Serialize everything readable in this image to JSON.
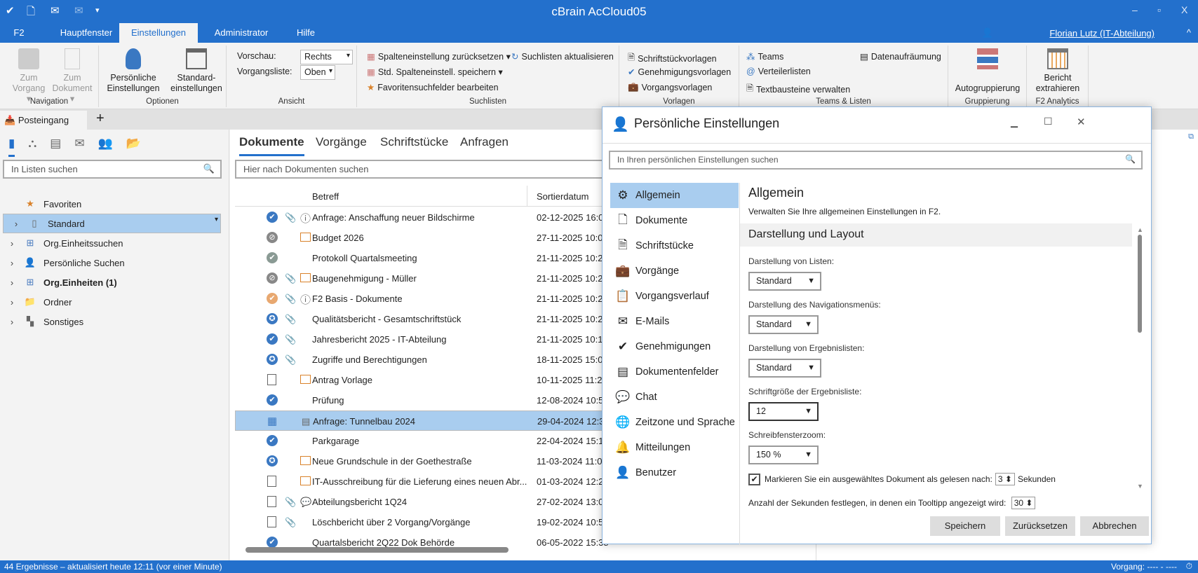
{
  "window": {
    "title": "cBrain AcCloud05",
    "minimize": "–",
    "maximize": "▫",
    "close": "X"
  },
  "quick_access": [
    "✔",
    "🗋",
    "✉",
    "✉",
    "▾"
  ],
  "menu": {
    "tabs": [
      "F2",
      "Hauptfenster",
      "Einstellungen",
      "Administrator",
      "Hilfe"
    ],
    "active": "Einstellungen",
    "user": "Florian Lutz (IT-Abteilung)",
    "collapse": "^"
  },
  "ribbon": {
    "navigation": {
      "label": "Navigation",
      "zum_vorgang": "Zum Vorgang ▾",
      "zum_dokument": "Zum Dokument ▾"
    },
    "optionen": {
      "label": "Optionen",
      "persoenlich": "Persönliche Einstellungen",
      "standard": "Standard-einstellungen"
    },
    "ansicht": {
      "label": "Ansicht",
      "vorschau_label": "Vorschau:",
      "vorschau_value": "Rechts",
      "vorgangsliste_label": "Vorgangsliste:",
      "vorgangsliste_value": "Oben"
    },
    "suchlisten": {
      "label": "Suchlisten",
      "reset": "Spalteneinstellung zurücksetzen ▾",
      "save": "Std. Spalteneinstell. speichern ▾",
      "fav": "Favoritensuchfelder bearbeiten",
      "refresh": "Suchlisten aktualisieren"
    },
    "vorlagen": {
      "label": "Vorlagen",
      "items": [
        "Schriftstückvorlagen",
        "Genehmigungsvorlagen",
        "Vorgangsvorlagen"
      ]
    },
    "teams": {
      "label": "Teams & Listen",
      "items": [
        "Teams",
        "Verteilerlisten",
        "Textbausteine verwalten",
        "Datenaufräumung"
      ]
    },
    "gruppierung": {
      "label": "Gruppierung",
      "auto": "Autogruppierung"
    },
    "analytics": {
      "label": "F2 Analytics",
      "bericht": "Bericht extrahieren"
    }
  },
  "doc_tab": {
    "label": "Posteingang",
    "add": "+"
  },
  "left": {
    "search_placeholder": "In Listen suchen",
    "tree": [
      {
        "label": "Favoriten",
        "icon": "★",
        "color": "#d9822b",
        "chev": ""
      },
      {
        "label": "Standard",
        "icon": "▯",
        "color": "#666",
        "chev": "›"
      },
      {
        "label": "Org.Einheitssuchen",
        "icon": "⊞",
        "color": "#4a7bbf",
        "chev": "›"
      },
      {
        "label": "Persönliche Suchen",
        "icon": "👤",
        "color": "#4a7bbf",
        "chev": "›"
      },
      {
        "label": "Org.Einheiten (1)",
        "icon": "⊞",
        "color": "#4a7bbf",
        "chev": "›"
      },
      {
        "label": "Ordner",
        "icon": "📁",
        "color": "#e8a860",
        "chev": "›"
      },
      {
        "label": "Sonstiges",
        "icon": "▚",
        "color": "#666",
        "chev": "›"
      }
    ]
  },
  "center": {
    "tabs": [
      "Dokumente",
      "Vorgänge",
      "Schriftstücke",
      "Anfragen"
    ],
    "search_placeholder": "Hier nach Dokumenten suchen",
    "columns": [
      "Betreff",
      "Sortierdatum"
    ],
    "rows": [
      {
        "status": "check",
        "status_color": "#3a78c2",
        "clip": true,
        "extra": "ⓘ",
        "subject": "Anfrage: Anschaffung neuer Bildschirme",
        "date": "02-12-2025 16:07"
      },
      {
        "status": "blocked",
        "status_color": "#888",
        "clip": false,
        "extra": "folder",
        "subject": "Budget 2026",
        "date": "27-11-2025 10:09"
      },
      {
        "status": "check",
        "status_color": "#8a9a94",
        "clip": false,
        "extra": "",
        "subject": "Protokoll Quartalsmeeting",
        "date": "21-11-2025 10:29"
      },
      {
        "status": "blocked",
        "status_color": "#888",
        "clip": true,
        "extra": "folder",
        "subject": "Baugenehmigung - Müller",
        "date": "21-11-2025 10:28"
      },
      {
        "status": "check",
        "status_color": "#e8a870",
        "clip": true,
        "extra": "ⓘ",
        "subject": "F2 Basis - Dokumente",
        "date": "21-11-2025 10:27"
      },
      {
        "status": "seal",
        "status_color": "#3a78c2",
        "clip": true,
        "extra": "",
        "subject": "Qualitätsbericht - Gesamtschriftstück",
        "date": "21-11-2025 10:24"
      },
      {
        "status": "check",
        "status_color": "#3a78c2",
        "clip": true,
        "extra": "",
        "subject": "Jahresbericht 2025 - IT-Abteilung",
        "date": "21-11-2025 10:17"
      },
      {
        "status": "seal",
        "status_color": "#3a78c2",
        "clip": true,
        "extra": "",
        "subject": "Zugriffe und Berechtigungen",
        "date": "18-11-2025 15:08"
      },
      {
        "status": "doc",
        "status_color": "#666",
        "clip": false,
        "extra": "folder",
        "subject": "Antrag Vorlage",
        "date": "10-11-2025 11:29"
      },
      {
        "status": "check",
        "status_color": "#3a78c2",
        "clip": false,
        "extra": "",
        "subject": "Prüfung",
        "date": "12-08-2024 10:59"
      },
      {
        "status": "request",
        "status_color": "#3a78c2",
        "clip": false,
        "extra": "list",
        "subject": "Anfrage: Tunnelbau 2024",
        "date": "29-04-2024 12:34",
        "selected": true
      },
      {
        "status": "check",
        "status_color": "#3a78c2",
        "clip": false,
        "extra": "",
        "subject": "Parkgarage",
        "date": "22-04-2024 15:15"
      },
      {
        "status": "seal",
        "status_color": "#3a78c2",
        "clip": false,
        "extra": "folder",
        "subject": "Neue Grundschule in der Goethestraße",
        "date": "11-03-2024 11:02"
      },
      {
        "status": "doc",
        "status_color": "#666",
        "clip": false,
        "extra": "folder",
        "subject": "IT-Ausschreibung für die Lieferung eines neuen Abr...",
        "date": "01-03-2024 12:29"
      },
      {
        "status": "doc",
        "status_color": "#666",
        "clip": true,
        "extra": "chat",
        "subject": "Abteilungsbericht 1Q24",
        "date": "27-02-2024 13:07"
      },
      {
        "status": "doc",
        "status_color": "#666",
        "clip": true,
        "extra": "",
        "subject": "Löschbericht über 2 Vorgang/Vorgänge",
        "date": "19-02-2024 10:50"
      },
      {
        "status": "check",
        "status_color": "#3a78c2",
        "clip": false,
        "extra": "",
        "subject": "Quartalsbericht 2Q22 Dok Behörde",
        "date": "06-05-2022 15:38"
      }
    ]
  },
  "status_bar": {
    "left": "44 Ergebnisse – aktualisiert heute 12:11 (vor einer Minute)",
    "right": "Vorgang: ---- - ----"
  },
  "dialog": {
    "title": "Persönliche Einstellungen",
    "search_placeholder": "In Ihren persönlichen Einstellungen suchen",
    "nav": [
      {
        "label": "Allgemein",
        "icon": "⚙"
      },
      {
        "label": "Dokumente",
        "icon": "🗋"
      },
      {
        "label": "Schriftstücke",
        "icon": "🗎"
      },
      {
        "label": "Vorgänge",
        "icon": "💼"
      },
      {
        "label": "Vorgangsverlauf",
        "icon": "📋"
      },
      {
        "label": "E-Mails",
        "icon": "✉"
      },
      {
        "label": "Genehmigungen",
        "icon": "✔"
      },
      {
        "label": "Dokumentenfelder",
        "icon": "▤"
      },
      {
        "label": "Chat",
        "icon": "💬"
      },
      {
        "label": "Zeitzone und Sprache",
        "icon": "🌐"
      },
      {
        "label": "Mitteilungen",
        "icon": "🔔"
      },
      {
        "label": "Benutzer",
        "icon": "👤"
      }
    ],
    "active_nav": "Allgemein",
    "heading": "Allgemein",
    "description": "Verwalten Sie Ihre allgemeinen Einstellungen in F2.",
    "section": "Darstellung und Layout",
    "fields": [
      {
        "label": "Darstellung von Listen:",
        "value": "Standard"
      },
      {
        "label": "Darstellung des Navigationsmenüs:",
        "value": "Standard"
      },
      {
        "label": "Darstellung von Ergebnislisten:",
        "value": "Standard"
      },
      {
        "label": "Schriftgröße der Ergebnisliste:",
        "value": "12"
      },
      {
        "label": "Schreibfensterzoom:",
        "value": "150 %"
      }
    ],
    "mark_read": {
      "checked": true,
      "label": "Markieren Sie ein ausgewähltes Dokument als gelesen nach:",
      "value": "3",
      "unit": "Sekunden"
    },
    "tooltip": {
      "label": "Anzahl der Sekunden festlegen, in denen ein Tooltipp angezeigt wird:",
      "value": "30"
    },
    "buttons": {
      "save": "Speichern",
      "reset": "Zurücksetzen",
      "cancel": "Abbrechen"
    }
  }
}
